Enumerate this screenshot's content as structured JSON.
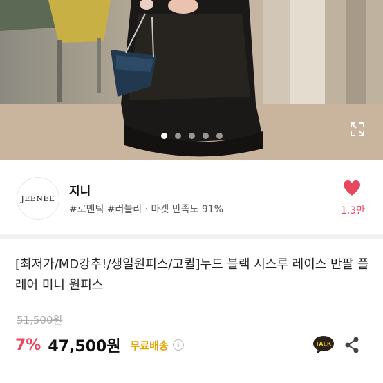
{
  "gallery": {
    "page_count": 5,
    "active_index": 0,
    "expand_icon": "expand-icon"
  },
  "seller": {
    "logo_text": "JEENEE",
    "name": "지니",
    "meta": "#로맨틱 #러블리 · 마켓 만족도 91%",
    "likes": "1.3만",
    "heart_color": "#e8485f"
  },
  "product": {
    "title": "[최저가/MD강추!/생일원피스/고퀼]누드 블랙 시스루 레이스 반팔 플레어 미니 원피스",
    "original_price": "51,500원",
    "discount": "7%",
    "price": "47,500원",
    "shipping": "무료배송",
    "accent_color": "#e8485f",
    "shipping_color": "#e8a200"
  },
  "actions": {
    "talk_label": "TALK"
  }
}
